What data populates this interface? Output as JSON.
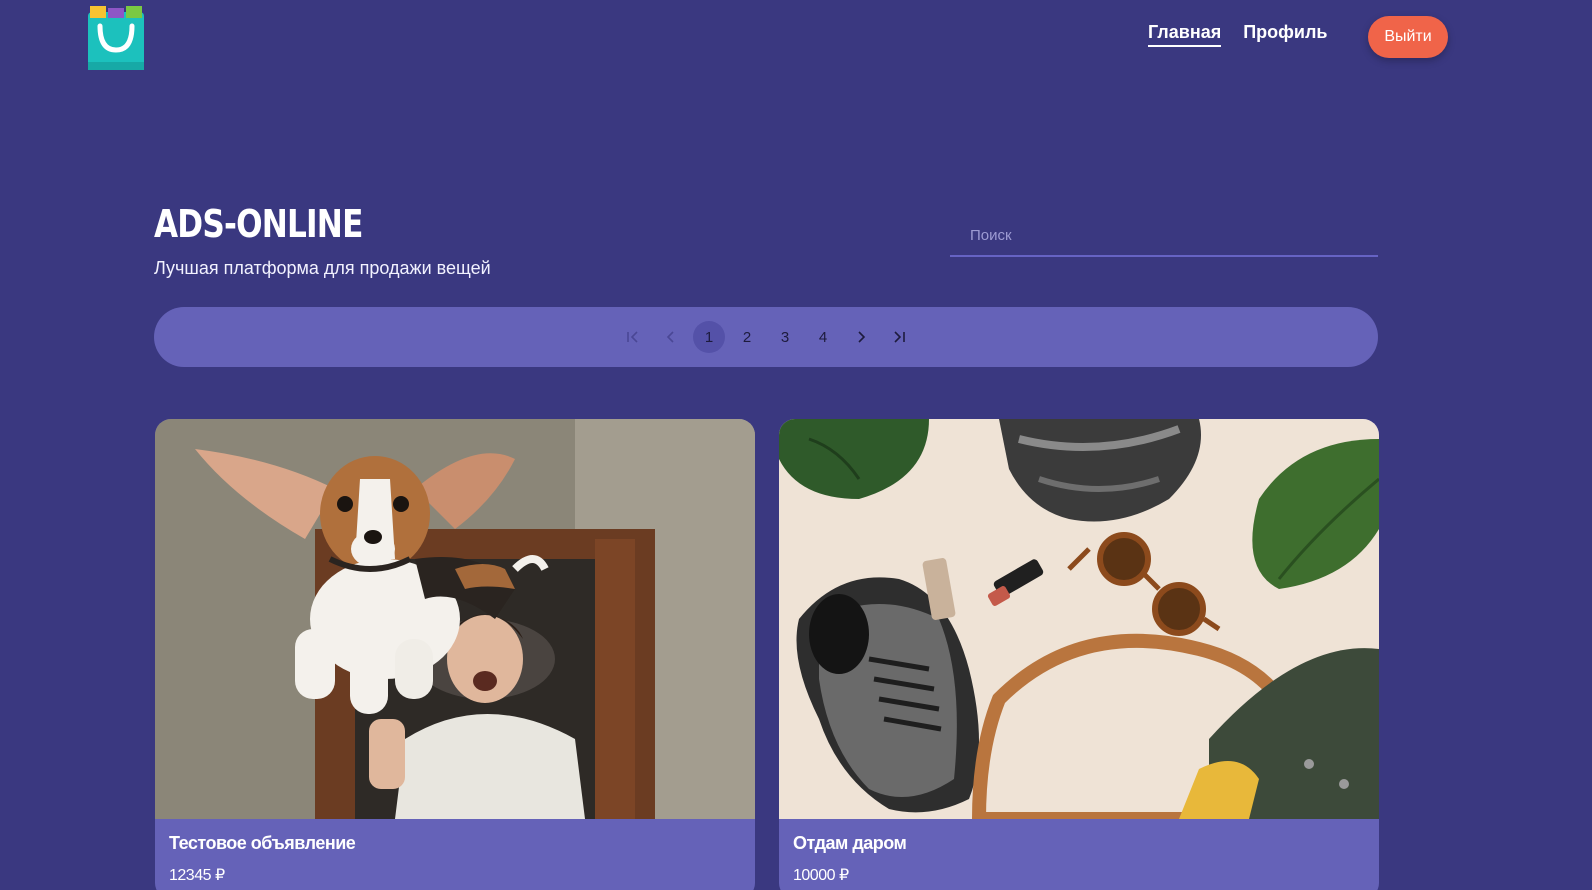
{
  "header": {
    "logo": "shopping-bag-logo",
    "nav": [
      {
        "label": "Главная",
        "active": true
      },
      {
        "label": "Профиль",
        "active": false
      }
    ],
    "logout_label": "Выйти"
  },
  "hero": {
    "title": "ADS-ONLINE",
    "subtitle": "Лучшая платформа для продажи вещей"
  },
  "search": {
    "placeholder": "Поиск",
    "value": ""
  },
  "pagination": {
    "pages": [
      "1",
      "2",
      "3",
      "4"
    ],
    "current": "1",
    "icons": [
      "first-page-icon",
      "prev-page-icon",
      "next-page-icon",
      "last-page-icon"
    ]
  },
  "ads": [
    {
      "title": "Тестовое объявление",
      "price": "12345 ₽",
      "image": "flying-beagle-photo"
    },
    {
      "title": "Отдам даром",
      "price": "10000 ₽",
      "image": "sneakers-flatlay-photo"
    }
  ],
  "colors": {
    "background": "#3a3880",
    "panel": "#6562b8",
    "accent": "#f06449",
    "logo": "#1cc1bd"
  }
}
